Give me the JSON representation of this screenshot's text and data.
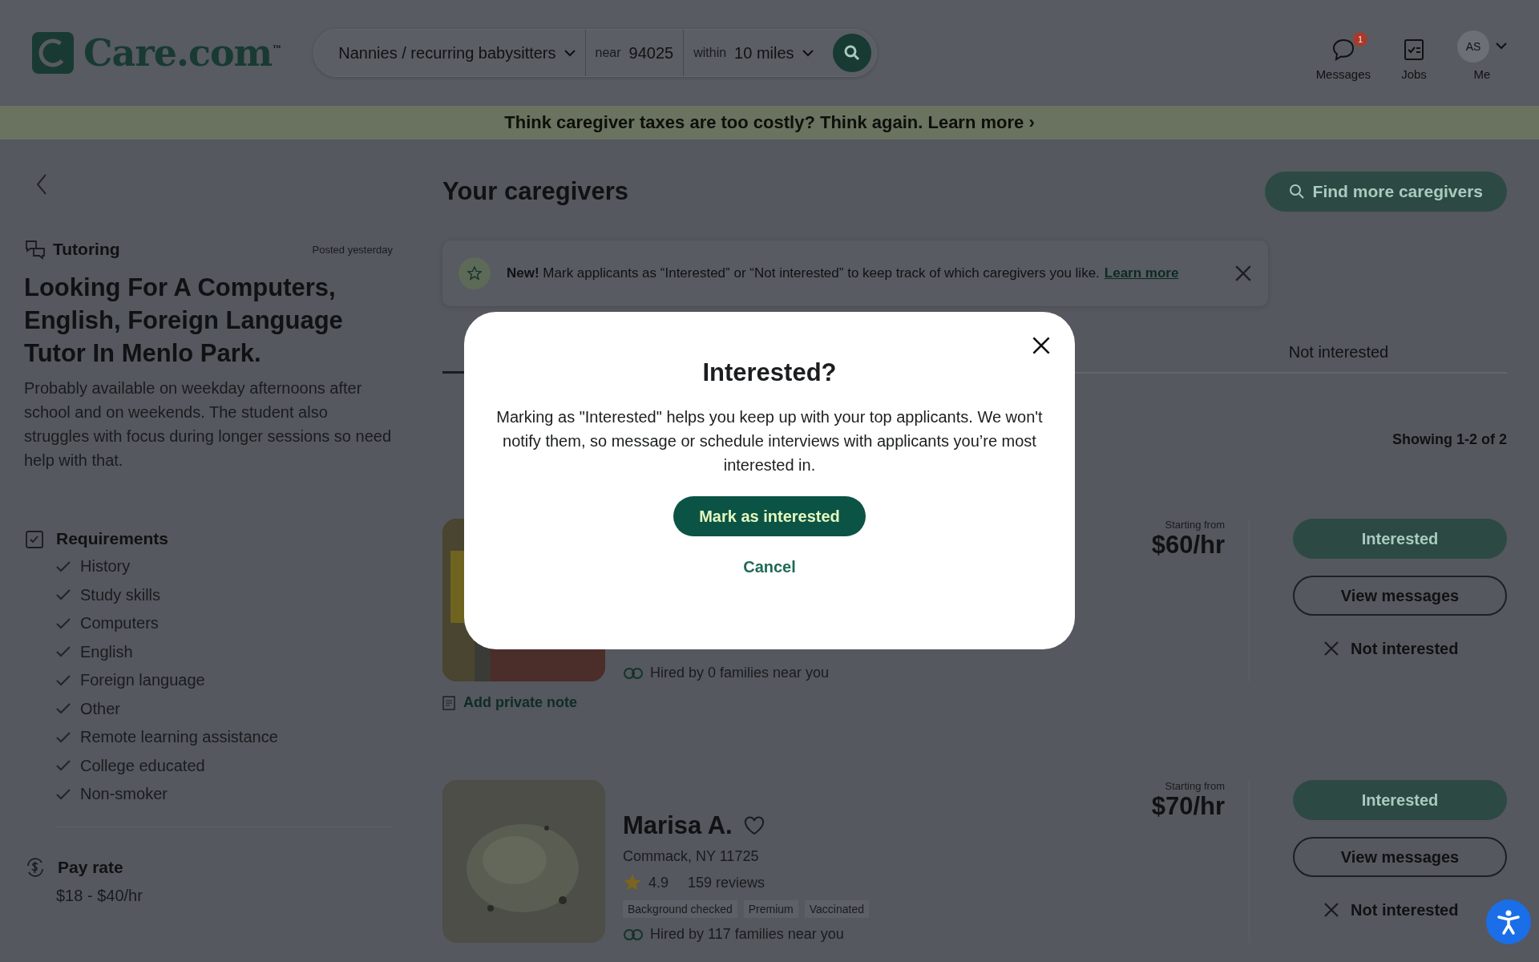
{
  "header": {
    "logo": "Care.com",
    "logo_mark": "™",
    "search": {
      "category": "Nannies / recurring babysitters",
      "near_label": "near",
      "zip": "94025",
      "within_label": "within",
      "distance": "10 miles"
    },
    "nav": [
      {
        "kind": "messages",
        "label": "Messages",
        "badge": "1"
      },
      {
        "kind": "jobs",
        "label": "Jobs"
      },
      {
        "kind": "avatar",
        "label": "Me",
        "initials": "AS"
      }
    ]
  },
  "banner": "Think caregiver taxes are too costly? Think again. Learn more ›",
  "job": {
    "category": "Tutoring",
    "posted": "Posted yesterday",
    "title": "Looking For A Computers, English, Foreign Language Tutor In Menlo Park.",
    "description": "Probably available on weekday afternoons after school and on weekends. The student also struggles with focus during longer sessions so need help with that.",
    "requirements_title": "Requirements",
    "requirements": [
      "History",
      "Study skills",
      "Computers",
      "English",
      "Foreign language",
      "Other",
      "Remote learning assistance",
      "College educated",
      "Non-smoker"
    ],
    "pay_title": "Pay rate",
    "pay": "$18 - $40/hr"
  },
  "main": {
    "title": "Your caregivers",
    "find_button": "Find more caregivers",
    "notice": {
      "text": "**New!** Mark applicants as “Interested” or “Not interested” to keep track of which caregivers you like.",
      "link": "Learn more"
    },
    "tabs": [
      {
        "label": "Not interested",
        "selected": false
      }
    ],
    "showing": "Showing 1-2 of 2",
    "cards": [
      {
        "price_label": "Starting from",
        "price": "$60/hr",
        "hired": "Hired by 0 families near you",
        "note": "Add private note",
        "interested": "Interested",
        "view": "View messages",
        "not_interested": "Not interested"
      },
      {
        "name": "Marisa A.",
        "location": "Commack, NY 11725",
        "rating": "4.9",
        "reviews": "159 reviews",
        "tags": [
          "Background checked",
          "Premium",
          "Vaccinated"
        ],
        "price_label": "Starting from",
        "price": "$70/hr",
        "hired": "Hired by 117 families near you",
        "interested": "Interested",
        "view": "View messages",
        "not_interested": "Not interested"
      }
    ]
  },
  "modal": {
    "title": "Interested?",
    "body": "Marking as \"Interested\" helps you keep up with your top applicants. We won't notify them, so message or schedule interviews with applicants you’re most interested in.",
    "confirm": "Mark as interested",
    "cancel": "Cancel"
  }
}
